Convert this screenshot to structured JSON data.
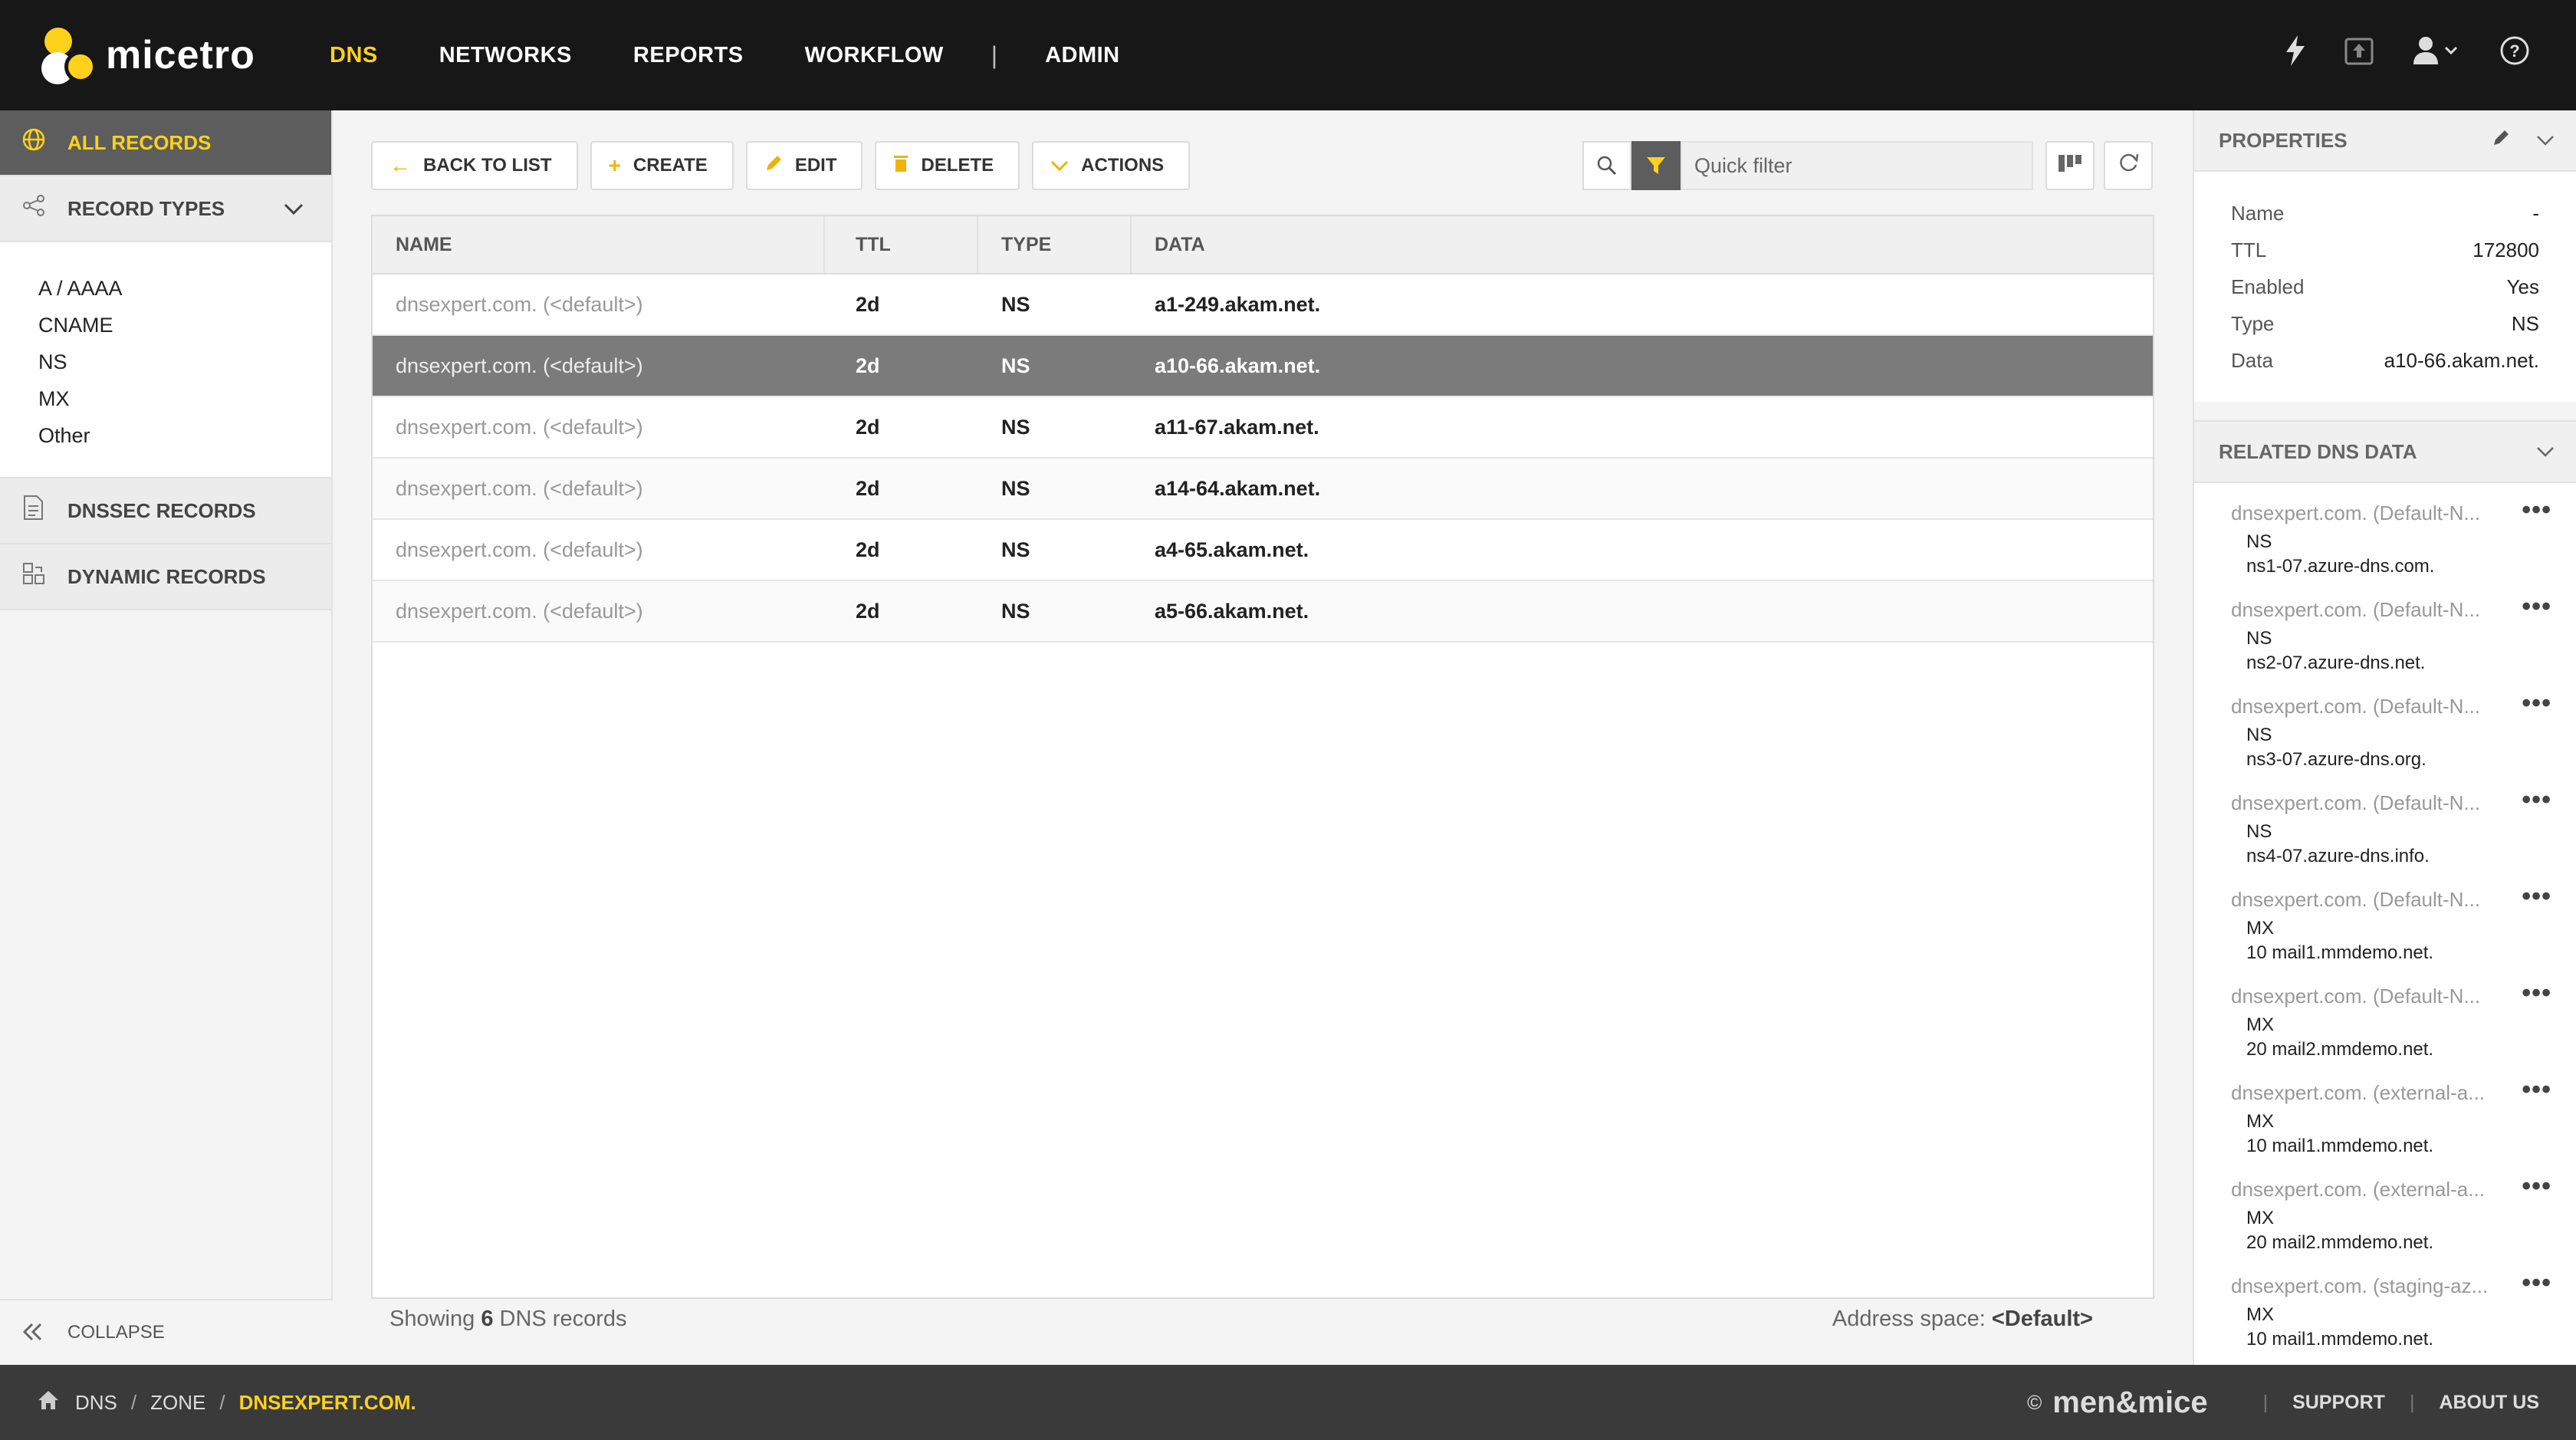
{
  "app": {
    "name": "micetro"
  },
  "nav": {
    "items": [
      {
        "label": "DNS",
        "active": true
      },
      {
        "label": "NETWORKS"
      },
      {
        "label": "REPORTS"
      },
      {
        "label": "WORKFLOW"
      },
      {
        "label": "ADMIN"
      }
    ],
    "separator": "|"
  },
  "sidebar": {
    "all_records": "ALL RECORDS",
    "record_types": "RECORD TYPES",
    "types": [
      "A / AAAA",
      "CNAME",
      "NS",
      "MX",
      "Other"
    ],
    "dnssec": "DNSSEC RECORDS",
    "dynamic": "DYNAMIC RECORDS",
    "collapse": "COLLAPSE"
  },
  "toolbar": {
    "back": "BACK TO LIST",
    "create": "CREATE",
    "edit": "EDIT",
    "delete": "DELETE",
    "actions": "ACTIONS",
    "filter_placeholder": "Quick filter"
  },
  "table": {
    "columns": [
      "NAME",
      "TTL",
      "TYPE",
      "DATA"
    ],
    "rows": [
      {
        "name": "dnsexpert.com. (<default>)",
        "ttl": "2d",
        "type": "NS",
        "data": "a1-249.akam.net."
      },
      {
        "name": "dnsexpert.com. (<default>)",
        "ttl": "2d",
        "type": "NS",
        "data": "a10-66.akam.net.",
        "selected": true
      },
      {
        "name": "dnsexpert.com. (<default>)",
        "ttl": "2d",
        "type": "NS",
        "data": "a11-67.akam.net."
      },
      {
        "name": "dnsexpert.com. (<default>)",
        "ttl": "2d",
        "type": "NS",
        "data": "a14-64.akam.net."
      },
      {
        "name": "dnsexpert.com. (<default>)",
        "ttl": "2d",
        "type": "NS",
        "data": "a4-65.akam.net."
      },
      {
        "name": "dnsexpert.com. (<default>)",
        "ttl": "2d",
        "type": "NS",
        "data": "a5-66.akam.net."
      }
    ]
  },
  "status": {
    "prefix": "Showing",
    "count": "6",
    "suffix": "DNS records",
    "address_label": "Address space:",
    "address_value": "<Default>"
  },
  "properties": {
    "title": "PROPERTIES",
    "items": [
      {
        "key": "Name",
        "value": "-"
      },
      {
        "key": "TTL",
        "value": "172800"
      },
      {
        "key": "Enabled",
        "value": "Yes"
      },
      {
        "key": "Type",
        "value": "NS"
      },
      {
        "key": "Data",
        "value": "a10-66.akam.net."
      }
    ]
  },
  "related": {
    "title": "RELATED DNS DATA",
    "items": [
      {
        "name": "dnsexpert.com. (Default-N...",
        "type": "NS",
        "data": "ns1-07.azure-dns.com."
      },
      {
        "name": "dnsexpert.com. (Default-N...",
        "type": "NS",
        "data": "ns2-07.azure-dns.net."
      },
      {
        "name": "dnsexpert.com. (Default-N...",
        "type": "NS",
        "data": "ns3-07.azure-dns.org."
      },
      {
        "name": "dnsexpert.com. (Default-N...",
        "type": "NS",
        "data": "ns4-07.azure-dns.info."
      },
      {
        "name": "dnsexpert.com. (Default-N...",
        "type": "MX",
        "data": "10 mail1.mmdemo.net."
      },
      {
        "name": "dnsexpert.com. (Default-N...",
        "type": "MX",
        "data": "20 mail2.mmdemo.net."
      },
      {
        "name": "dnsexpert.com. (external-a...",
        "type": "MX",
        "data": "10 mail1.mmdemo.net."
      },
      {
        "name": "dnsexpert.com. (external-a...",
        "type": "MX",
        "data": "20 mail2.mmdemo.net."
      },
      {
        "name": "dnsexpert.com. (staging-az...",
        "type": "MX",
        "data": "10 mail1.mmdemo.net."
      }
    ]
  },
  "footer": {
    "breadcrumb": [
      "DNS",
      "ZONE",
      "DNSEXPERT.COM."
    ],
    "copyright": "©",
    "brand": "men&mice",
    "support": "SUPPORT",
    "about": "ABOUT US"
  },
  "colors": {
    "accent": "#ffd11a",
    "topbar": "#171717",
    "footer": "#3a3a3a",
    "selected_row": "#7b7b7b"
  },
  "icons": [
    "bolt-icon",
    "export-icon",
    "user-icon",
    "help-icon",
    "globe-icon",
    "share-icon",
    "document-icon",
    "dynamic-icon",
    "search-icon",
    "filter-icon",
    "columns-icon",
    "refresh-icon",
    "pencil-icon",
    "home-icon"
  ]
}
